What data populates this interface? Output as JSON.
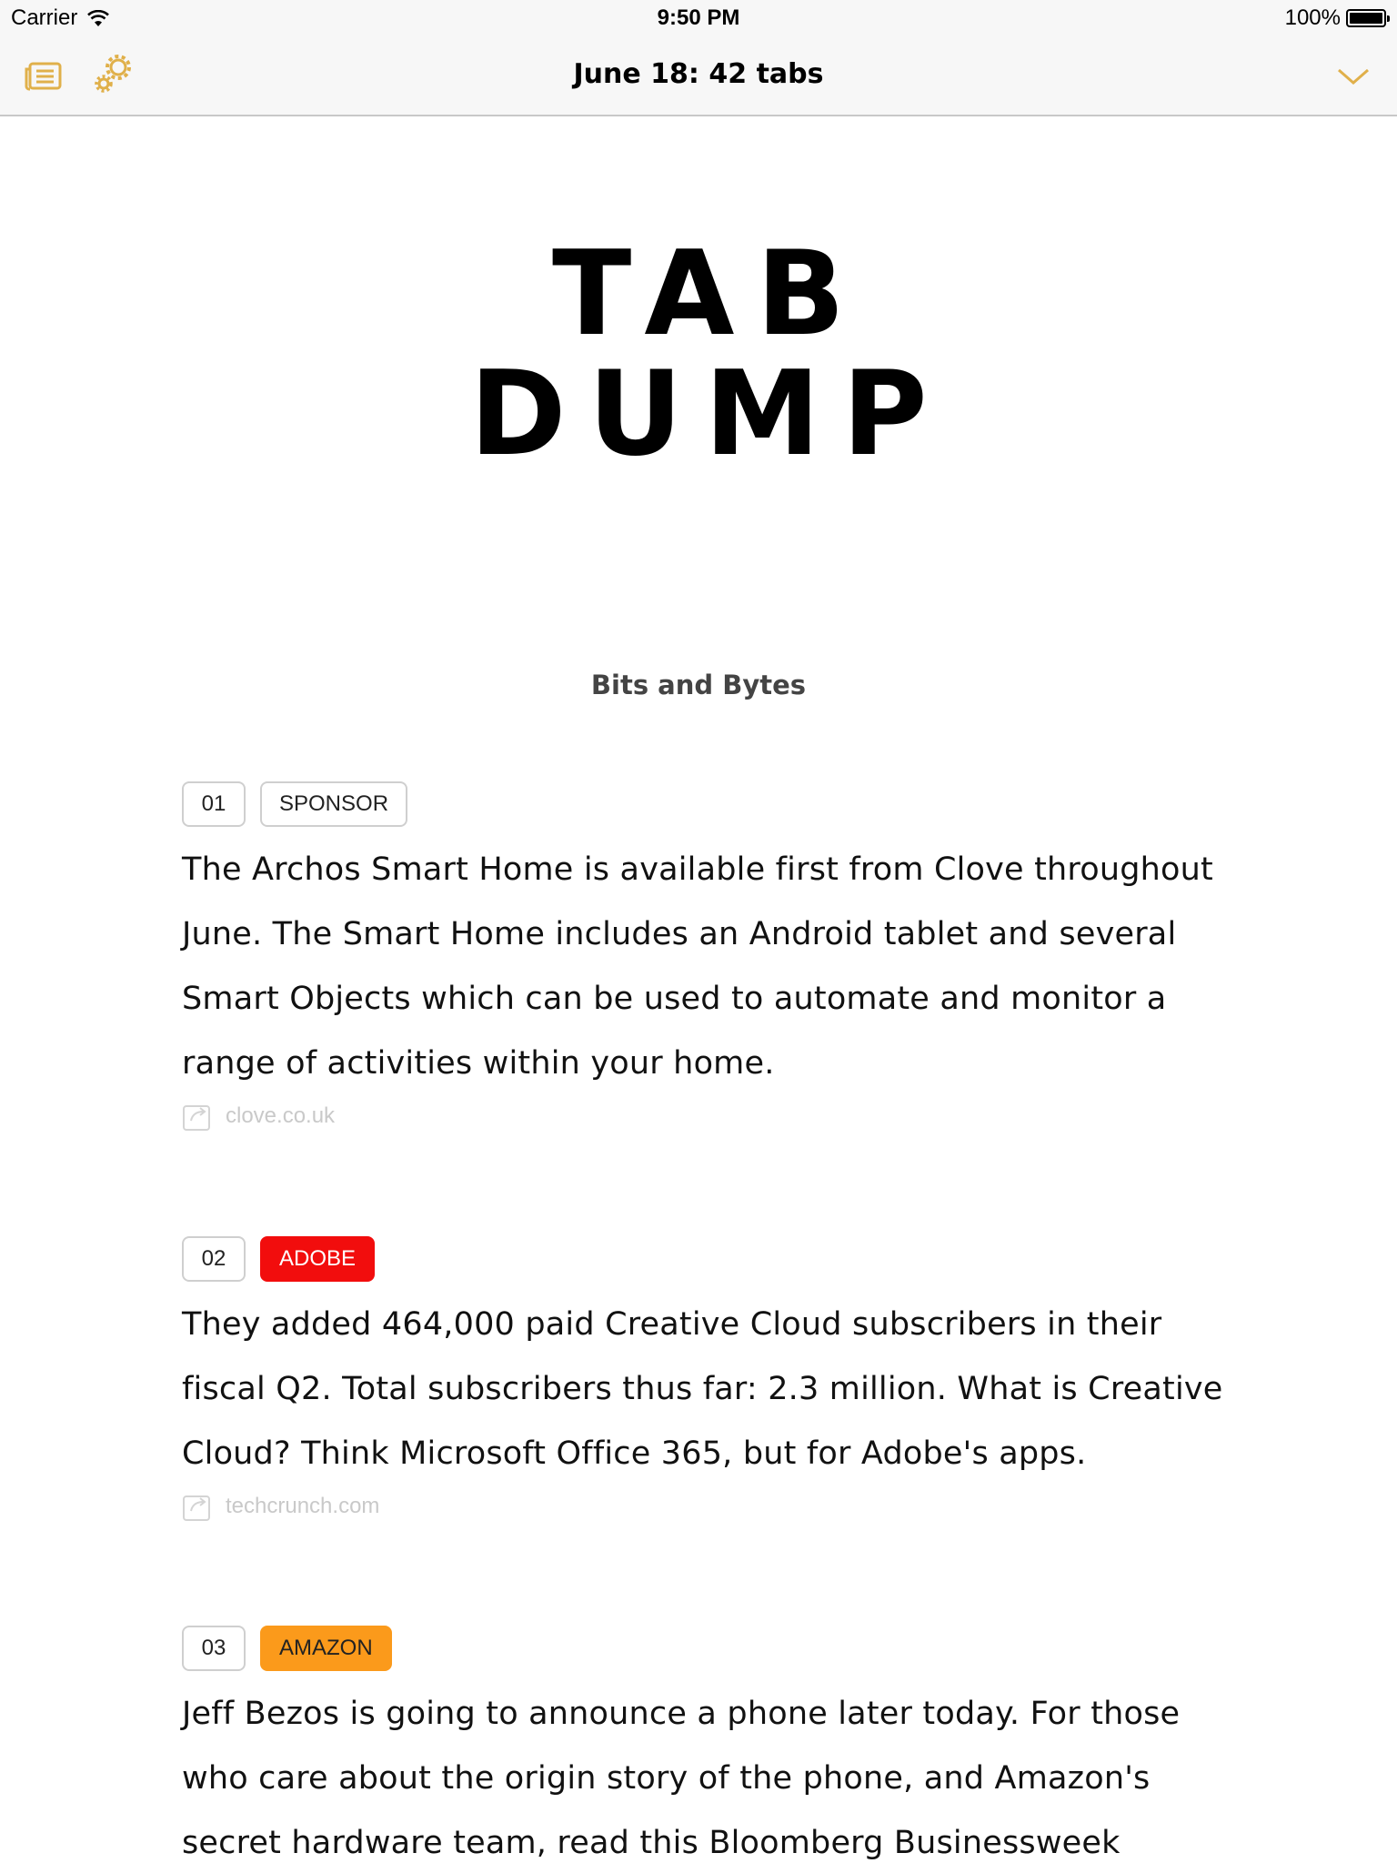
{
  "status_bar": {
    "carrier": "Carrier",
    "time": "9:50 PM",
    "battery": "100%"
  },
  "nav": {
    "title": "June 18: 42 tabs"
  },
  "logo": {
    "line1": "TAB",
    "line2": "DUMP"
  },
  "section": {
    "title": "Bits and Bytes"
  },
  "items": [
    {
      "number": "01",
      "tag": "SPONSOR",
      "tag_color": "#ffffff",
      "text": "The Archos Smart Home is available first from Clove throughout June. The Smart Home includes an Android tablet and several Smart Objects which can be used to automate and monitor a range of activities within your home.",
      "source": "clove.co.uk"
    },
    {
      "number": "02",
      "tag": "ADOBE",
      "tag_color": "#f20d0d",
      "text": "They added 464,000 paid Creative Cloud subscribers in their fiscal Q2. Total subscribers thus far: 2.3 million. What is Creative Cloud? Think Microsoft Office 365, but for Adobe's apps.",
      "source": "techcrunch.com"
    },
    {
      "number": "03",
      "tag": "AMAZON",
      "tag_color": "#fb9a1b",
      "text": "Jeff Bezos is going to announce a phone later today. For those who care about the origin story of the phone, and Amazon's secret hardware team, read this Bloomberg Businessweek",
      "source": ""
    }
  ],
  "accent_color": "#e0b04a"
}
